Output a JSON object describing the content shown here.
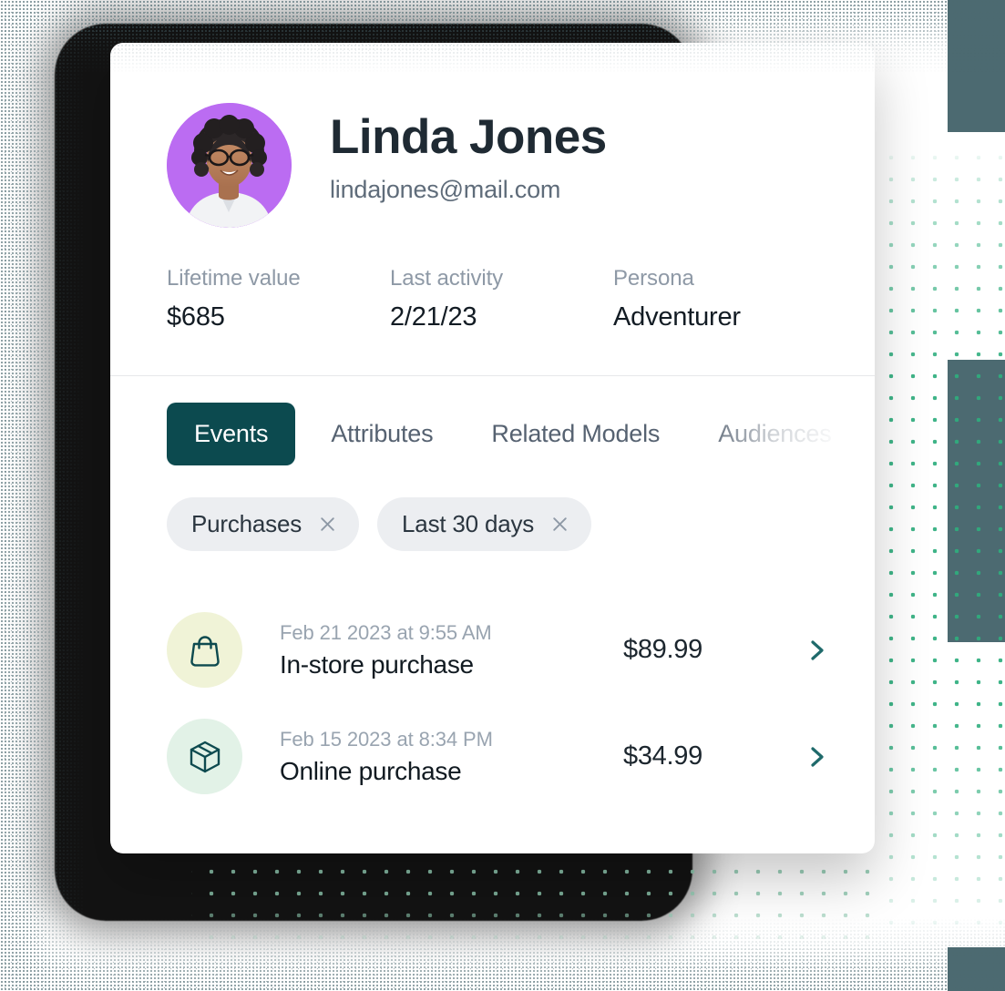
{
  "profile": {
    "name": "Linda Jones",
    "email": "lindajones@mail.com",
    "avatar_icon": "user-portrait-avatar",
    "avatar_bg": "#bb6cf2"
  },
  "stats": [
    {
      "label": "Lifetime value",
      "value": "$685"
    },
    {
      "label": "Last activity",
      "value": "2/21/23"
    },
    {
      "label": "Persona",
      "value": "Adventurer"
    }
  ],
  "tabs": [
    {
      "label": "Events",
      "active": true
    },
    {
      "label": "Attributes",
      "active": false
    },
    {
      "label": "Related Models",
      "active": false
    },
    {
      "label": "Audiences",
      "active": false
    }
  ],
  "filters": [
    {
      "label": "Purchases",
      "close_icon": "close-icon"
    },
    {
      "label": "Last 30 days",
      "close_icon": "close-icon"
    }
  ],
  "events": [
    {
      "icon": "shopping-bag-icon",
      "time": "Feb 21 2023 at 9:55 AM",
      "title": "In-store purchase",
      "amount": "$89.99",
      "chevron": "chevron-right-icon"
    },
    {
      "icon": "package-box-icon",
      "time": "Feb 15 2023 at 8:34 PM",
      "title": "Online purchase",
      "amount": "$34.99",
      "chevron": "chevron-right-icon"
    }
  ],
  "colors": {
    "accent_dark_teal": "#0c4a4f",
    "chevron_teal": "#1f6a6b",
    "chip_bg": "#eceef1",
    "dot_green": "#2fae7e",
    "slate_teal": "#4c6a71"
  }
}
